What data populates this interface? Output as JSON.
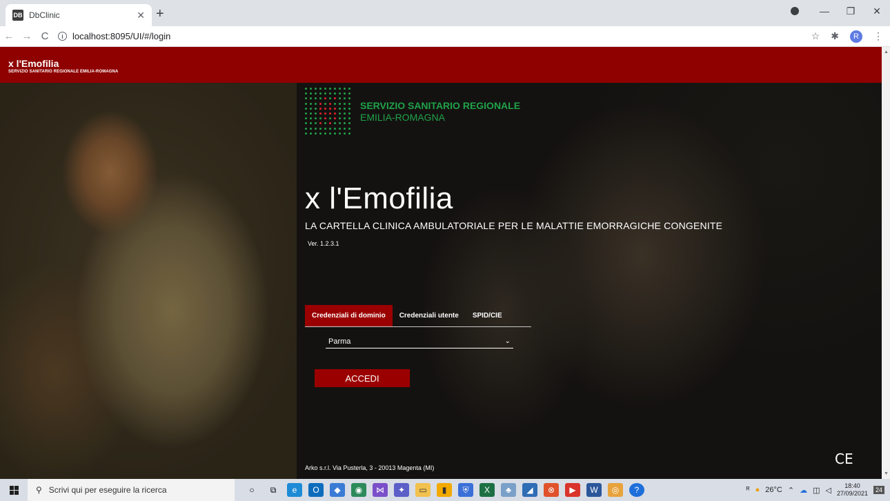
{
  "browser": {
    "tab_title": "DbClinic",
    "favicon_text": "DB",
    "url": "localhost:8095/UI/#/login",
    "avatar_letter": "R"
  },
  "header": {
    "title": "x l'Emofilia",
    "subtitle": "SERVIZIO SANITARIO REGIONALE EMILIA-ROMAGNA"
  },
  "logo": {
    "line1": "SERVIZIO SANITARIO REGIONALE",
    "line2": "EMILIA-ROMAGNA",
    "green": "#1fa24a",
    "red": "#e2222c"
  },
  "main": {
    "title": "x l'Emofilia",
    "subtitle": "LA CARTELLA CLINICA AMBULATORIALE PER LE MALATTIE EMORRAGICHE CONGENITE",
    "version": "Ver. 1.2.3.1"
  },
  "login": {
    "tabs": [
      {
        "label": "Credenziali di dominio",
        "active": true
      },
      {
        "label": "Credenziali utente",
        "active": false
      },
      {
        "label": "SPID/CIE",
        "active": false
      }
    ],
    "domain_value": "Parma",
    "submit_label": "ACCEDI"
  },
  "footer": {
    "company": "Arko s.r.l. Via Pusterla, 3 - 20013 Magenta (MI)",
    "ce_mark": "CE"
  },
  "taskbar": {
    "search_placeholder": "Scrivi qui per eseguire la ricerca",
    "weather": "26°C",
    "time": "18:40",
    "date": "27/09/2021",
    "notifications": "24"
  },
  "colors": {
    "brand_red": "#8f0000",
    "button_red": "#9b0000"
  }
}
